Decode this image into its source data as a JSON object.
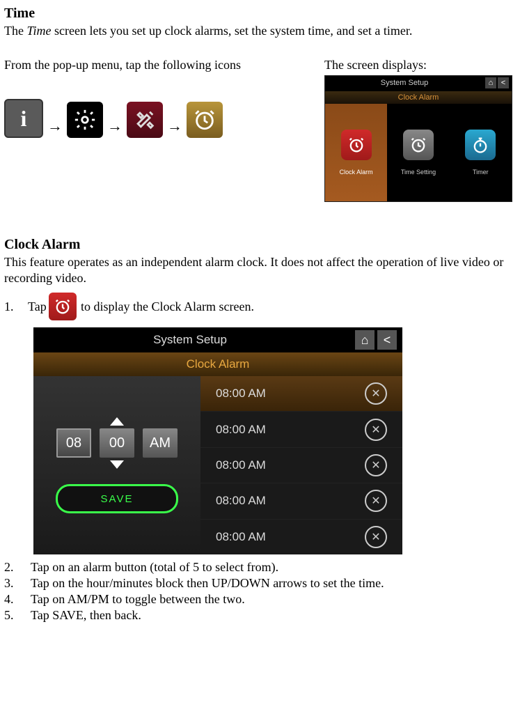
{
  "section_time": {
    "title": "Time",
    "intro_prefix": "The ",
    "intro_em": "Time",
    "intro_suffix": " screen lets you set up clock alarms, set the system time, and set a timer.",
    "left_text": "From the pop-up menu, tap the following icons",
    "right_text": "The screen displays:"
  },
  "icon_arrow": "→",
  "screen_small": {
    "title": "System Setup",
    "sub": "Clock Alarm",
    "tiles": [
      {
        "label": "Clock Alarm",
        "color": "red",
        "selected": true
      },
      {
        "label": "Time Setting",
        "color": "gray",
        "selected": false
      },
      {
        "label": "Timer",
        "color": "blue",
        "selected": false
      }
    ]
  },
  "section_clockalarm": {
    "title": "Clock Alarm",
    "desc": "This feature operates as an independent alarm clock. It does not affect the operation of live video or recording video.",
    "step1_num": "1.",
    "step1_pre": "Tap",
    "step1_post": " to display the Clock Alarm screen."
  },
  "screen_large": {
    "title": "System Setup",
    "sub": "Clock Alarm",
    "hour": "08",
    "minute": "00",
    "ampm": "AM",
    "save": "SAVE",
    "alarms": [
      {
        "time": "08:00 AM",
        "on": true
      },
      {
        "time": "08:00 AM",
        "on": false
      },
      {
        "time": "08:00 AM",
        "on": false
      },
      {
        "time": "08:00 AM",
        "on": false
      },
      {
        "time": "08:00 AM",
        "on": false
      }
    ]
  },
  "steps": [
    {
      "n": "2.",
      "t": "Tap on an alarm button (total of 5 to select from)."
    },
    {
      "n": "3.",
      "t": "Tap on the hour/minutes block then UP/DOWN arrows to set the time."
    },
    {
      "n": "4.",
      "t": "Tap on AM/PM to toggle between the two."
    },
    {
      "n": "5.",
      "t": "Tap SAVE, then back."
    }
  ]
}
